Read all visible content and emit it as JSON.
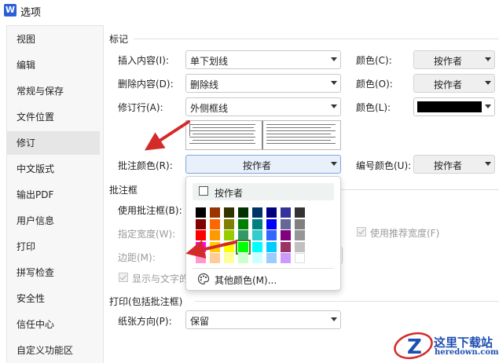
{
  "window": {
    "title": "选项",
    "app_icon": "W"
  },
  "sidebar": {
    "items": [
      {
        "label": "视图"
      },
      {
        "label": "编辑"
      },
      {
        "label": "常规与保存"
      },
      {
        "label": "文件位置"
      },
      {
        "label": "修订",
        "active": true
      },
      {
        "label": "中文版式"
      },
      {
        "label": "输出PDF"
      },
      {
        "label": "用户信息"
      },
      {
        "label": "打印"
      },
      {
        "label": "拼写检查"
      },
      {
        "label": "安全性"
      },
      {
        "label": "信任中心"
      },
      {
        "label": "自定义功能区"
      }
    ]
  },
  "markup": {
    "section": "标记",
    "insert_label": "插入内容(I):",
    "insert_value": "单下划线",
    "insert_color_label": "颜色(C):",
    "insert_color_value": "按作者",
    "delete_label": "删除内容(D):",
    "delete_value": "删除线",
    "delete_color_label": "颜色(O):",
    "delete_color_value": "按作者",
    "changed_line_label": "修订行(A):",
    "changed_line_value": "外侧框线",
    "changed_line_color_label": "颜色(L):",
    "changed_line_color_value": "#000000",
    "comment_color_label": "批注颜色(R):",
    "comment_color_value": "按作者",
    "number_color_label": "编号颜色(U):",
    "number_color_value": "按作者"
  },
  "balloons": {
    "section": "批注框",
    "use_label": "使用批注框(B):",
    "width_label": "指定宽度(W):",
    "margin_label": "边距(M):",
    "show_lines_label": "显示与文字的",
    "recommended_width_label": "使用推荐宽度(F)"
  },
  "printing": {
    "section": "打印(包括批注框)",
    "orientation_label": "纸张方向(P):",
    "orientation_value": "保留"
  },
  "color_popup": {
    "auto_label": "按作者",
    "more_colors_label": "其他颜色(M)...",
    "selected": "#00ff00",
    "colors": [
      [
        "#000000",
        "#993300",
        "#333300",
        "#003300",
        "#003366",
        "#000080",
        "#333399",
        "#333333"
      ],
      [
        "#800000",
        "#ff6600",
        "#808000",
        "#008000",
        "#008080",
        "#0000ff",
        "#666699",
        "#808080"
      ],
      [
        "#ff0000",
        "#ff9900",
        "#99cc00",
        "#339966",
        "#33cccc",
        "#3366ff",
        "#800080",
        "#969696"
      ],
      [
        "#ff00ff",
        "#ffcc00",
        "#ffff00",
        "#00ff00",
        "#00ffff",
        "#00ccff",
        "#993366",
        "#c0c0c0"
      ],
      [
        "#ff99cc",
        "#ffcc99",
        "#ffff99",
        "#ccffcc",
        "#ccffff",
        "#99ccff",
        "#cc99ff",
        "#ffffff"
      ]
    ]
  },
  "watermark": {
    "text_cn": "这里下载站",
    "text_en": "heredown.com"
  },
  "colors": {
    "accent": "#2b5fd9",
    "arrow": "#d42a2a",
    "focus_bg": "#e7f0fb"
  }
}
